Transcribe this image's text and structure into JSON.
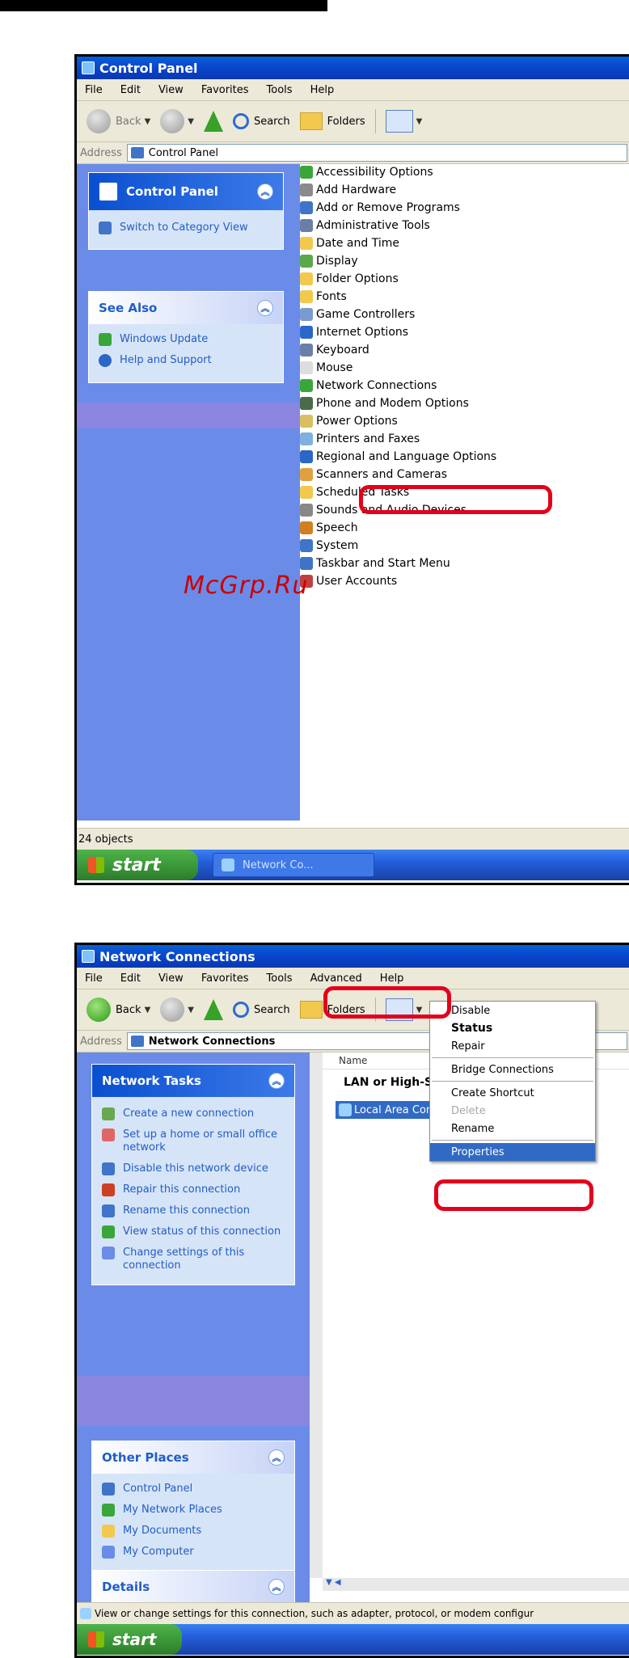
{
  "control_panel": {
    "title": "Control Panel",
    "menu": [
      "File",
      "Edit",
      "View",
      "Favorites",
      "Tools",
      "Help"
    ],
    "toolbar": {
      "back": "Back",
      "search": "Search",
      "folders": "Folders"
    },
    "address_label": "Address",
    "address_value": "Control Panel",
    "panel_header": "Control Panel",
    "switch_view": "Switch to Category View",
    "see_also": "See Also",
    "see_also_items": [
      "Windows Update",
      "Help and Support"
    ],
    "items": [
      "Accessibility Options",
      "Add Hardware",
      "Add or Remove Programs",
      "Administrative Tools",
      "Date and Time",
      "Display",
      "Folder Options",
      "Fonts",
      "Game Controllers",
      "Internet Options",
      "Keyboard",
      "Mouse",
      "Network Connections",
      "Phone and Modem Options",
      "Power Options",
      "Printers and Faxes",
      "Regional and Language Options",
      "Scanners and Cameras",
      "Scheduled Tasks",
      "Sounds and Audio Devices",
      "Speech",
      "System",
      "Taskbar and Start Menu",
      "User Accounts"
    ],
    "status_text": "24 objects",
    "taskbar_button": "Network Co..."
  },
  "watermark": "McGrp.Ru",
  "network_connections": {
    "title": "Network Connections",
    "menu": [
      "File",
      "Edit",
      "View",
      "Favorites",
      "Tools",
      "Advanced",
      "Help"
    ],
    "toolbar": {
      "back": "Back",
      "search": "Search",
      "folders": "Folders"
    },
    "address_label": "Address",
    "address_value": "Network Connections",
    "network_tasks_header": "Network Tasks",
    "network_tasks": [
      "Create a new connection",
      "Set up a home or small office network",
      "Disable this network device",
      "Repair this connection",
      "Rename this connection",
      "View status of this connection",
      "Change settings of this connection"
    ],
    "other_places_header": "Other Places",
    "other_places": [
      "Control Panel",
      "My Network Places",
      "My Documents",
      "My Computer"
    ],
    "details_header": "Details",
    "column_name": "Name",
    "group_header": "LAN or High-Speed Internet",
    "connection_label": "Local Area Con",
    "context_menu": {
      "disable": "Disable",
      "status": "Status",
      "repair": "Repair",
      "bridge": "Bridge Connections",
      "shortcut": "Create Shortcut",
      "delete": "Delete",
      "rename": "Rename",
      "properties": "Properties"
    },
    "status_text": "View or change settings for this connection, such as adapter, protocol, or modem configur",
    "start": "start"
  },
  "colors": {
    "highlight_box": "#e3001b",
    "xp_blue": "#0842c8",
    "task_pane": "#6a8ce8"
  }
}
